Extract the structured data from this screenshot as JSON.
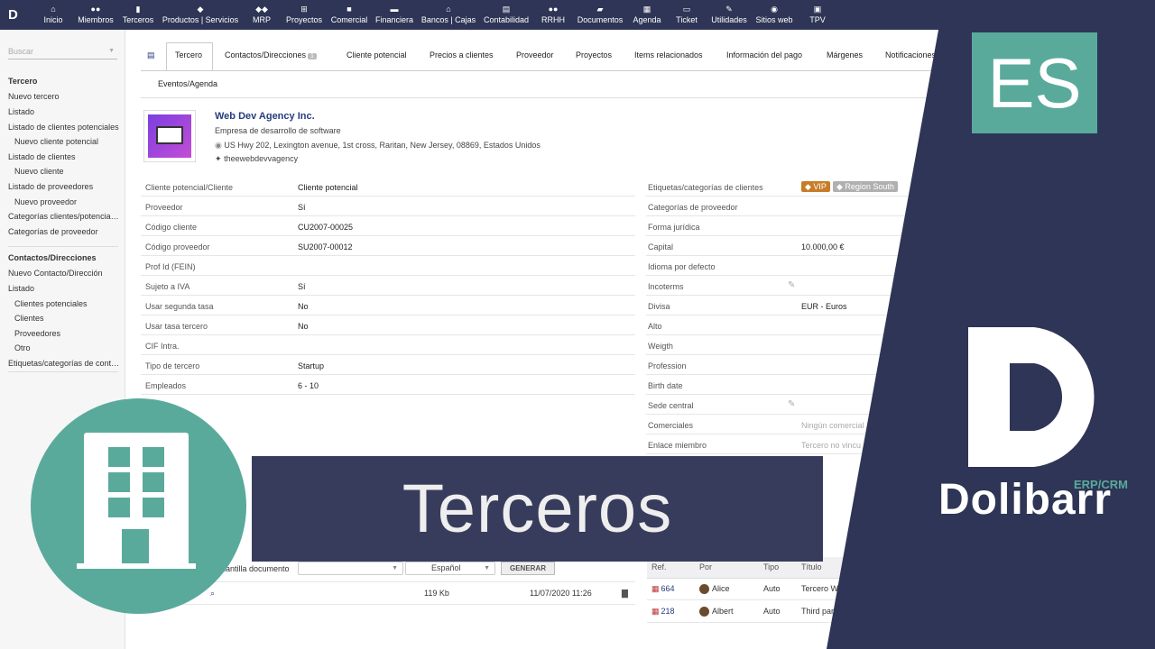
{
  "topmenu": [
    {
      "icon": "home-icon",
      "glyph": "⌂",
      "label": "Inicio"
    },
    {
      "icon": "members-icon",
      "glyph": "●●",
      "label": "Miembros"
    },
    {
      "icon": "building-icon",
      "glyph": "▮",
      "label": "Terceros"
    },
    {
      "icon": "cube-icon",
      "glyph": "◆",
      "label": "Productos | Servicios"
    },
    {
      "icon": "cubes-icon",
      "glyph": "◆◆",
      "label": "MRP"
    },
    {
      "icon": "sitemap-icon",
      "glyph": "⊞",
      "label": "Proyectos"
    },
    {
      "icon": "suitcase-icon",
      "glyph": "■",
      "label": "Comercial"
    },
    {
      "icon": "money-icon",
      "glyph": "▬",
      "label": "Financiera"
    },
    {
      "icon": "bank-icon",
      "glyph": "⌂",
      "label": "Bancos | Cajas"
    },
    {
      "icon": "ledger-icon",
      "glyph": "▤",
      "label": "Contabilidad"
    },
    {
      "icon": "users-icon",
      "glyph": "●●",
      "label": "RRHH"
    },
    {
      "icon": "folder-icon",
      "glyph": "▰",
      "label": "Documentos"
    },
    {
      "icon": "calendar-icon",
      "glyph": "▦",
      "label": "Agenda"
    },
    {
      "icon": "ticket-icon",
      "glyph": "▭",
      "label": "Ticket"
    },
    {
      "icon": "wrench-icon",
      "glyph": "✎",
      "label": "Utilidades"
    },
    {
      "icon": "globe-icon",
      "glyph": "◉",
      "label": "Sitios web"
    },
    {
      "icon": "pos-icon",
      "glyph": "▣",
      "label": "TPV"
    }
  ],
  "search_placeholder": "Buscar",
  "sidebar": [
    {
      "label": "Tercero",
      "kind": "t"
    },
    {
      "label": "Nuevo tercero",
      "kind": ""
    },
    {
      "label": "Listado",
      "kind": ""
    },
    {
      "label": "Listado de clientes potenciales",
      "kind": ""
    },
    {
      "label": "Nuevo cliente potencial",
      "kind": "s"
    },
    {
      "label": "Listado de clientes",
      "kind": ""
    },
    {
      "label": "Nuevo cliente",
      "kind": "s"
    },
    {
      "label": "Listado de proveedores",
      "kind": ""
    },
    {
      "label": "Nuevo proveedor",
      "kind": "s"
    },
    {
      "label": "Categorías clientes/potenciales",
      "kind": ""
    },
    {
      "label": "Categorías de proveedor",
      "kind": ""
    },
    {
      "label": "Contactos/Direcciones",
      "kind": "t"
    },
    {
      "label": "Nuevo Contacto/Dirección",
      "kind": ""
    },
    {
      "label": "Listado",
      "kind": ""
    },
    {
      "label": "Clientes potenciales",
      "kind": "s"
    },
    {
      "label": "Clientes",
      "kind": "s"
    },
    {
      "label": "Proveedores",
      "kind": "s"
    },
    {
      "label": "Otro",
      "kind": "s"
    },
    {
      "label": "Etiquetas/categorías de contactos",
      "kind": ""
    }
  ],
  "tabs": [
    "Tercero",
    "Contactos/Direcciones",
    "Cliente potencial",
    "Precios a clientes",
    "Proveedor",
    "Proyectos",
    "Items relacionados",
    "Información del pago",
    "Márgenes",
    "Notificaciones",
    "Eventos/Agenda"
  ],
  "contacts_count": "1",
  "company": {
    "name": "Web Dev Agency Inc.",
    "description": "Empresa de desarrollo de software",
    "address": "US Hwy 202, Lexington avenue, 1st cross, Raritan, New Jersey, 08869, Estados Unidos",
    "twitter": "theewebdevvagency"
  },
  "left_fields": [
    {
      "label": "Cliente potencial/Cliente",
      "value": "Cliente potencial"
    },
    {
      "label": "Proveedor",
      "value": "Sí"
    },
    {
      "label": "Código cliente",
      "value": "CU2007-00025"
    },
    {
      "label": "Código proveedor",
      "value": "SU2007-00012"
    },
    {
      "label": "Prof Id (FEIN)",
      "value": ""
    },
    {
      "label": "Sujeto a IVA",
      "value": "Sí"
    },
    {
      "label": "Usar segunda tasa",
      "value": "No"
    },
    {
      "label": "Usar tasa tercero",
      "value": "No"
    },
    {
      "label": "CIF Intra.",
      "value": ""
    },
    {
      "label": "Tipo de tercero",
      "value": "Startup"
    },
    {
      "label": "Empleados",
      "value": "6 - 10"
    }
  ],
  "right_fields": [
    {
      "label": "Etiquetas/categorías de clientes",
      "value": ""
    },
    {
      "label": "Categorías de proveedor",
      "value": ""
    },
    {
      "label": "Forma jurídica",
      "value": ""
    },
    {
      "label": "Capital",
      "value": "10.000,00 €"
    },
    {
      "label": "Idioma por defecto",
      "value": ""
    },
    {
      "label": "Incoterms",
      "value": ""
    },
    {
      "label": "Divisa",
      "value": "EUR - Euros"
    },
    {
      "label": "Alto",
      "value": ""
    },
    {
      "label": "Weigth",
      "value": ""
    },
    {
      "label": "Profession",
      "value": ""
    },
    {
      "label": "Birth date",
      "value": ""
    },
    {
      "label": "Sede central",
      "value": ""
    },
    {
      "label": "Comerciales",
      "value": "Ningún comercial"
    },
    {
      "label": "Enlace miembro",
      "value": "Tercero no vincu"
    }
  ],
  "tags": [
    {
      "label": "VIP",
      "color": "#c77d28"
    },
    {
      "label": "Region South",
      "color": "#b0b0b0"
    }
  ],
  "docgen": {
    "label": "lantilla documento",
    "lang": "Español",
    "button": "GENERAR"
  },
  "file": {
    "size": "119 Kb",
    "date": "11/07/2020 11:26"
  },
  "events": {
    "headers": [
      "Ref.",
      "Por",
      "Tipo",
      "Título"
    ],
    "rows": [
      {
        "ref": "664",
        "by": "Alice",
        "type": "Auto",
        "title": "Tercero W"
      },
      {
        "ref": "218",
        "by": "Albert",
        "type": "Auto",
        "title": "Third par"
      }
    ]
  },
  "overlay": {
    "title": "Terceros",
    "lang": "ES",
    "brand": "Dolibarr",
    "brand_sub": "ERP/CRM"
  }
}
